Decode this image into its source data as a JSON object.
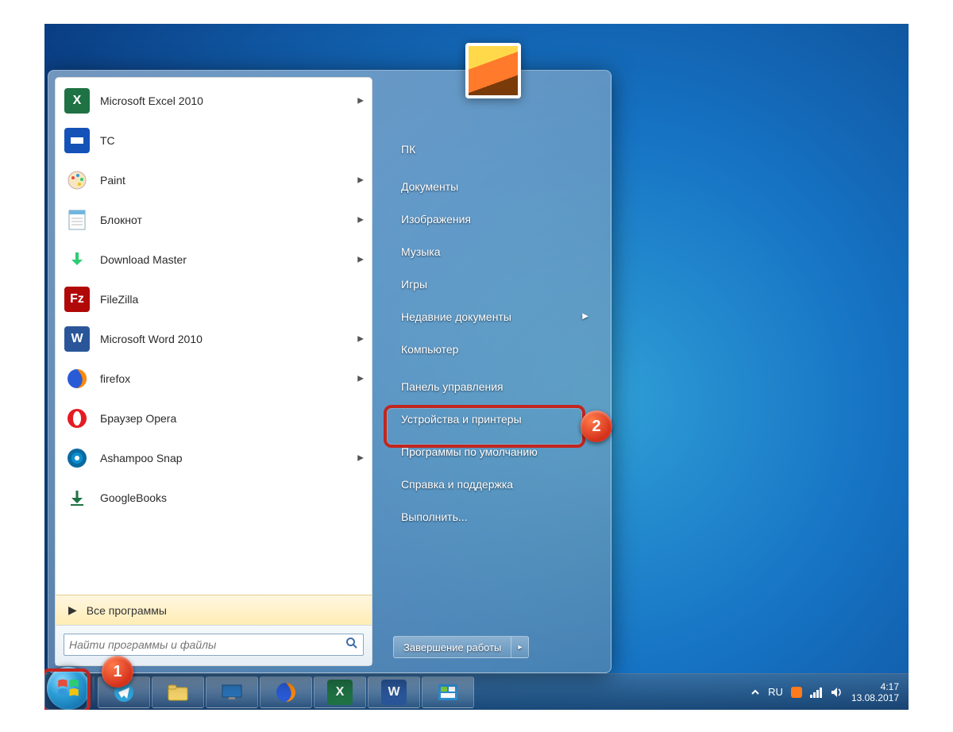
{
  "start_menu": {
    "apps": [
      {
        "label": "Microsoft Excel 2010",
        "submenu": true,
        "icon": "excel-icon"
      },
      {
        "label": "TC",
        "submenu": false,
        "icon": "tc-icon"
      },
      {
        "label": "Paint",
        "submenu": true,
        "icon": "paint-icon"
      },
      {
        "label": "Блокнот",
        "submenu": true,
        "icon": "notepad-icon"
      },
      {
        "label": "Download Master",
        "submenu": true,
        "icon": "dm-icon"
      },
      {
        "label": "FileZilla",
        "submenu": false,
        "icon": "filezilla-icon"
      },
      {
        "label": "Microsoft Word 2010",
        "submenu": true,
        "icon": "word-icon"
      },
      {
        "label": "firefox",
        "submenu": true,
        "icon": "firefox-icon"
      },
      {
        "label": "Браузер Opera",
        "submenu": false,
        "icon": "opera-icon"
      },
      {
        "label": "Ashampoo Snap",
        "submenu": true,
        "icon": "snap-icon"
      },
      {
        "label": "GoogleBooks",
        "submenu": false,
        "icon": "gbooks-icon"
      }
    ],
    "all_programs": "Все программы",
    "search_placeholder": "Найти программы и файлы",
    "right": [
      {
        "label": "ПК",
        "submenu": false
      },
      {
        "label": "Документы",
        "submenu": false
      },
      {
        "label": "Изображения",
        "submenu": false
      },
      {
        "label": "Музыка",
        "submenu": false
      },
      {
        "label": "Игры",
        "submenu": false
      },
      {
        "label": "Недавние документы",
        "submenu": true
      },
      {
        "label": "Компьютер",
        "submenu": false
      },
      {
        "label": "Панель управления",
        "submenu": false
      },
      {
        "label": "Устройства и принтеры",
        "submenu": false
      },
      {
        "label": "Программы по умолчанию",
        "submenu": false
      },
      {
        "label": "Справка и поддержка",
        "submenu": false
      },
      {
        "label": "Выполнить...",
        "submenu": false
      }
    ],
    "shutdown": "Завершение работы"
  },
  "taskbar": {
    "apps": [
      "telegram-icon",
      "explorer-icon",
      "desktop-icon",
      "firefox-icon",
      "excel-icon",
      "word-icon",
      "control-panel-icon"
    ]
  },
  "tray": {
    "lang": "RU",
    "time": "4:17",
    "date": "13.08.2017"
  },
  "callouts": {
    "badge1": "1",
    "badge2": "2"
  }
}
